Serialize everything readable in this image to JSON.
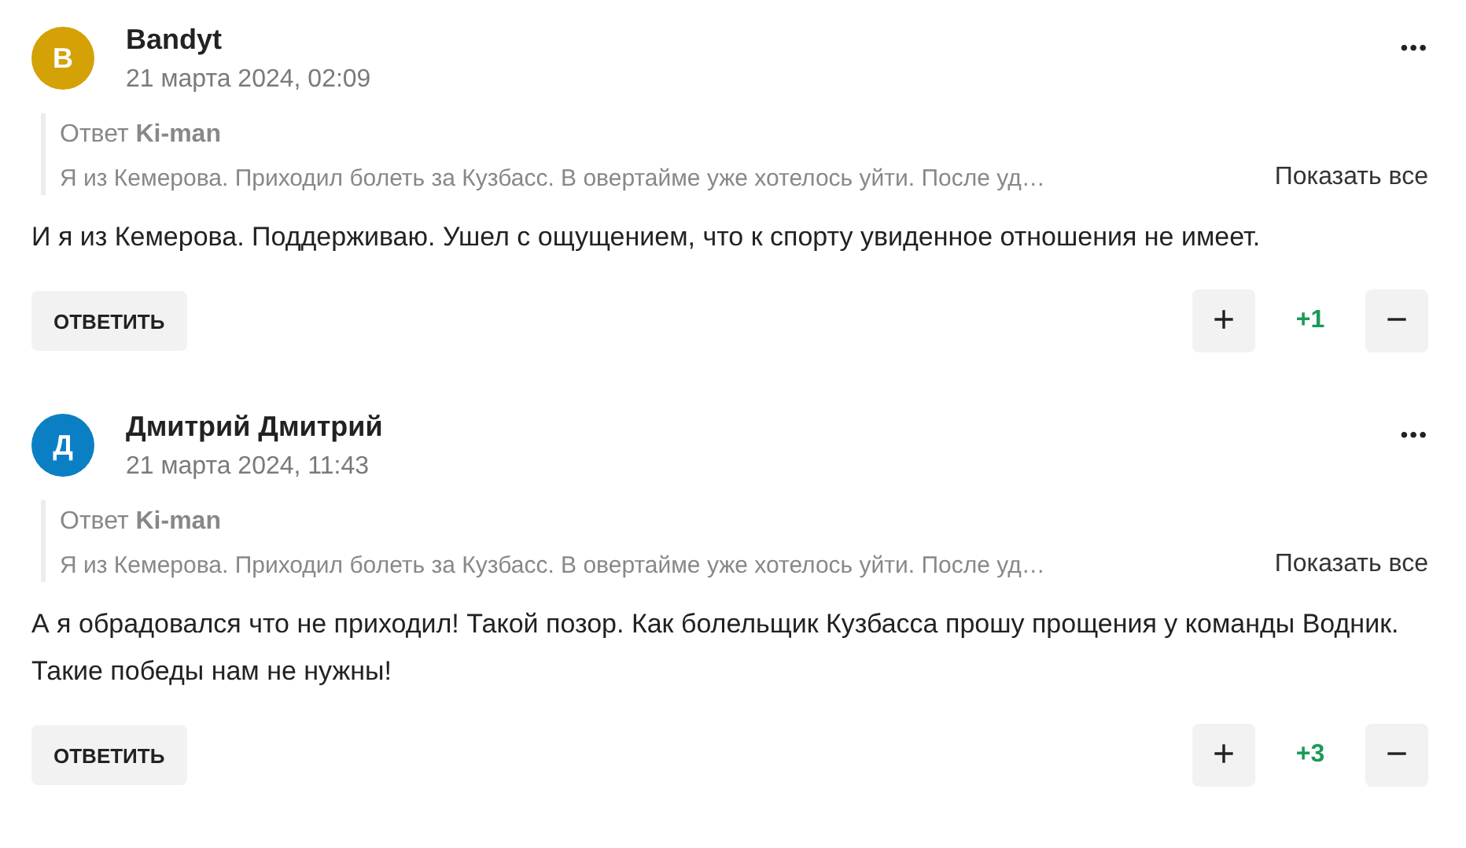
{
  "comments": [
    {
      "avatar_letter": "B",
      "color": "#d4a106",
      "author": "Bandyt",
      "date": "21 марта 2024, 02:09",
      "menu": "•••",
      "reply_to": {
        "label": "Ответ",
        "name": "Ki-man",
        "text": "Я из Кемерова. Приходил болеть за Кузбасс. В овертайме уже хотелось уйти. После уд…",
        "show_all": "Показать все"
      },
      "text": "И я из Кемерова. Поддерживаю. Ушел с ощущением, что к спорту увиденное отношения не имеет.",
      "reply_button": "ОТВЕТИТЬ",
      "plus": "+",
      "score": "+1",
      "minus": "−"
    },
    {
      "avatar_letter": "Д",
      "color": "#0a7fc4",
      "author": "Дмитрий Дмитрий",
      "date": "21 марта 2024, 11:43",
      "menu": "•••",
      "reply_to": {
        "label": "Ответ",
        "name": "Ki-man",
        "text": "Я из Кемерова. Приходил болеть за Кузбасс. В овертайме уже хотелось уйти. После уд…",
        "show_all": "Показать все"
      },
      "text": "А я обрадовался что не приходил! Такой позор. Как болельщик Кузбасса прошу прощения у команды Водник. Такие победы нам не нужны!",
      "reply_button": "ОТВЕТИТЬ",
      "plus": "+",
      "score": "+3",
      "minus": "−"
    }
  ]
}
